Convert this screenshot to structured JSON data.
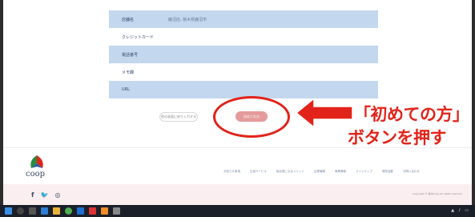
{
  "form": {
    "rows": [
      {
        "label": "店舗名",
        "value": "鹿沼店, 栃木県鹿沼市",
        "style": "blue"
      },
      {
        "label": "クレジットカード",
        "value": "",
        "style": "white"
      },
      {
        "label": "電話番号",
        "value": "",
        "style": "blue"
      },
      {
        "label": "メモ欄",
        "value": "",
        "style": "white"
      },
      {
        "label": "URL",
        "value": "",
        "style": "blue"
      }
    ]
  },
  "buttons": {
    "back_label": "前の画面に戻り入力する",
    "first_label": "初めての方"
  },
  "annotation": {
    "line1": "「初めての方」",
    "line2": "ボタンを押す"
  },
  "footer": {
    "logo_text": "coop",
    "nav": [
      "お知らせ事項",
      "生協サービス",
      "組合員になるメリット",
      "企業情報",
      "事業情報",
      "ラインナップ",
      "環境活動",
      "お問い合わせ"
    ],
    "social": [
      "f",
      "twitter-icon",
      "instagram-icon"
    ],
    "copyright": "Copyright © 栃木Coop All rights reserved."
  },
  "colors": {
    "accent_red": "#e2231a",
    "row_blue": "#c3d7ee",
    "button_pink": "#e59b9b"
  }
}
